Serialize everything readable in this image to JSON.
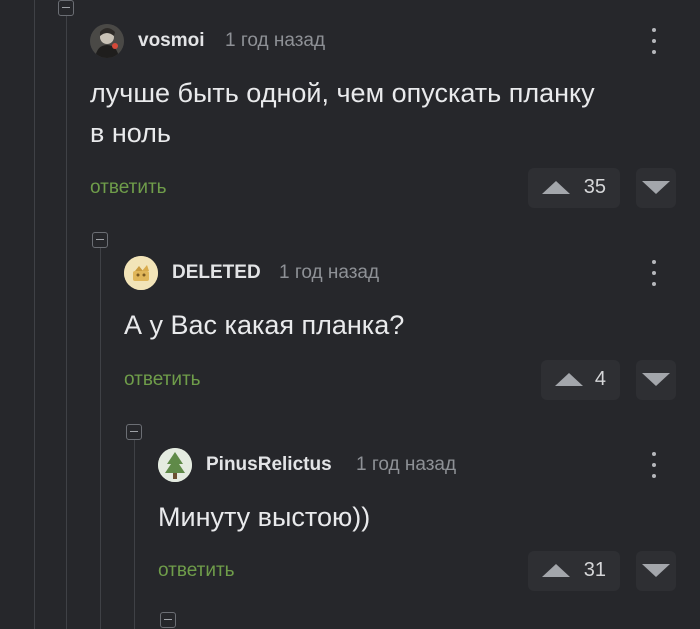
{
  "comments": [
    {
      "username": "vosmoi",
      "time": "1 год назад",
      "text_line1": "лучше быть одной, чем опускать планку",
      "text_line2": "в ноль",
      "reply_label": "ответить",
      "votes": "35",
      "avatar_icon": "user-photo-icon"
    },
    {
      "username": "DELETED",
      "time": "1 год назад",
      "text_line1": "А у Вас какая планка?",
      "reply_label": "ответить",
      "votes": "4",
      "avatar_icon": "deleted-user-icon"
    },
    {
      "username": "PinusRelictus",
      "time": "1 год назад",
      "text_line1": "Минуту выстою))",
      "reply_label": "ответить",
      "votes": "31",
      "avatar_icon": "pine-tree-icon"
    }
  ],
  "colors": {
    "background": "#26272b",
    "reply_link": "#6f9d4a",
    "vote_button": "#2e2f33",
    "thread_line": "#3f4146"
  }
}
